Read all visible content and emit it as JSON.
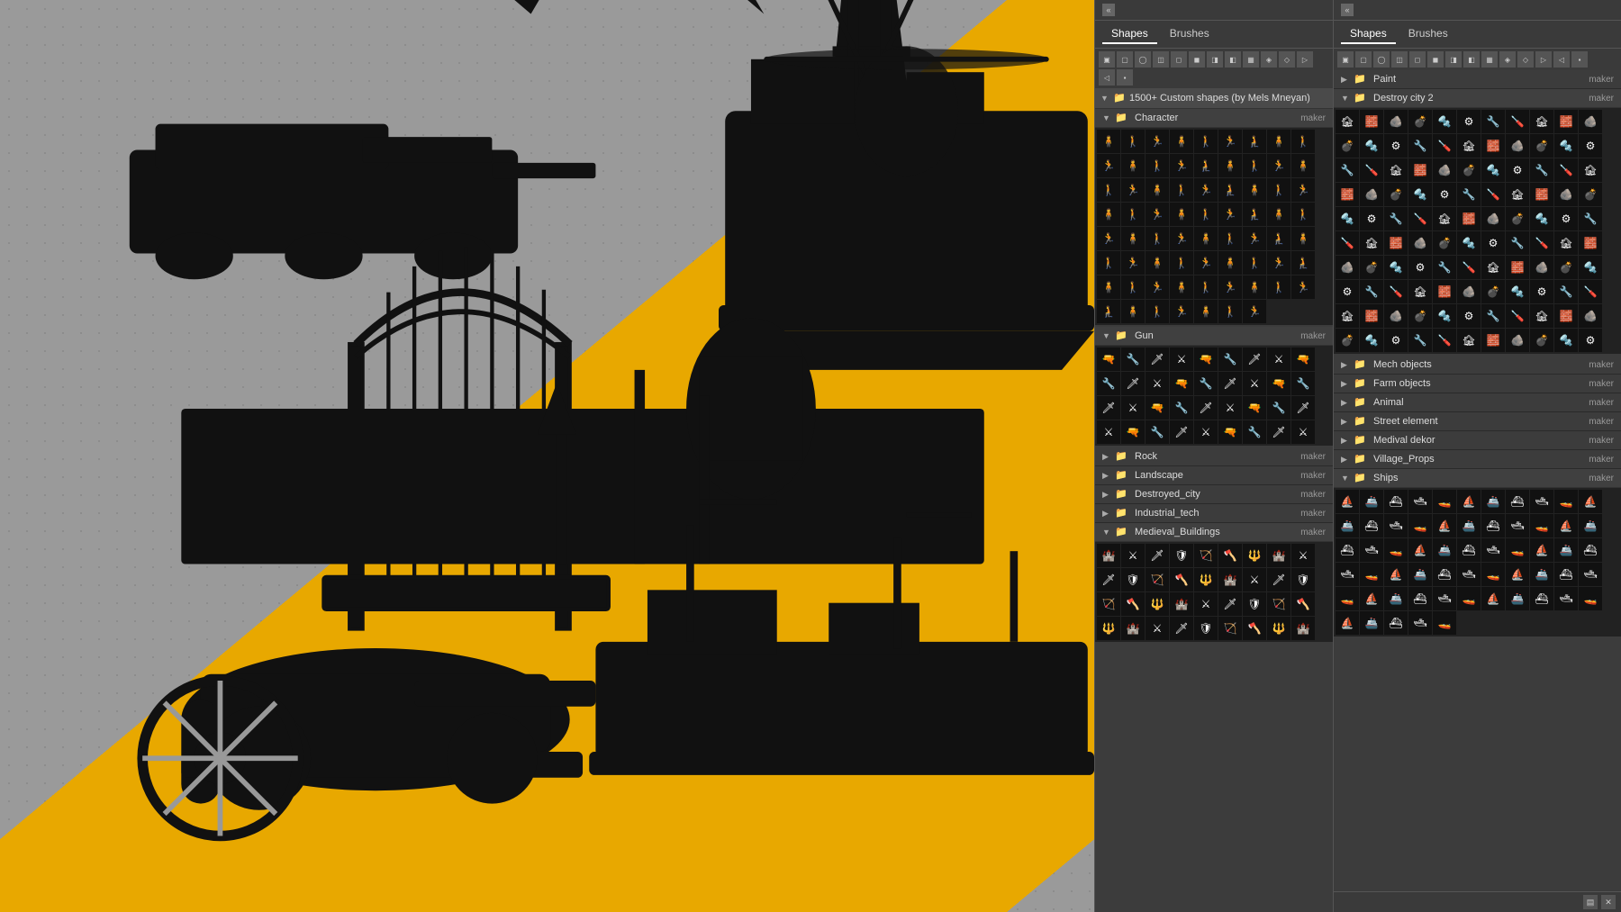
{
  "canvas": {
    "background_color": "#9a9a9a",
    "accent_color": "#e8a800"
  },
  "panel_left": {
    "collapse_btn": "«",
    "tabs": [
      {
        "label": "Shapes",
        "active": true
      },
      {
        "label": "Brushes",
        "active": false
      }
    ],
    "toolbar_icons": [
      "▣",
      "▢",
      "◯",
      "◫",
      "◻",
      "▤",
      "▦",
      "▨",
      "◈",
      "◇",
      "▷",
      "◁",
      "◻",
      "▪",
      "◻",
      "◻",
      "◻",
      "◻"
    ],
    "collection_title": "1500+ Custom shapes (by Mels Mneyan)",
    "groups": [
      {
        "name": "Character",
        "meta": "maker",
        "expanded": true,
        "grid_rows": 5
      },
      {
        "name": "Gun",
        "meta": "maker",
        "expanded": true,
        "grid_rows": 4
      },
      {
        "name": "Rock",
        "meta": "maker",
        "expanded": false
      },
      {
        "name": "Landscape",
        "meta": "maker",
        "expanded": false
      },
      {
        "name": "Destroyed_city",
        "meta": "maker",
        "expanded": false
      },
      {
        "name": "Industrial_tech",
        "meta": "maker",
        "expanded": false
      },
      {
        "name": "Medieval_Buildings",
        "meta": "maker",
        "expanded": true,
        "grid_rows": 4
      }
    ]
  },
  "panel_right": {
    "collapse_btn": "«",
    "tabs": [
      {
        "label": "Shapes",
        "active": true
      },
      {
        "label": "Brushes",
        "active": false
      }
    ],
    "toolbar_icons": [
      "▣",
      "▢",
      "◯",
      "◫",
      "◻",
      "▤",
      "▦",
      "▨",
      "◈",
      "◇",
      "▷",
      "◁",
      "◻",
      "▪",
      "◻",
      "◻",
      "◻",
      "◻"
    ],
    "groups": [
      {
        "name": "Paint",
        "meta": "maker",
        "expanded": false
      },
      {
        "name": "Destroy city 2",
        "meta": "maker",
        "expanded": true,
        "grid_rows": 10
      },
      {
        "name": "Mech objects",
        "meta": "maker",
        "expanded": false
      },
      {
        "name": "Farm objects",
        "meta": "maker",
        "expanded": false
      },
      {
        "name": "Animal",
        "meta": "maker",
        "expanded": false
      },
      {
        "name": "Street element",
        "meta": "maker",
        "expanded": false
      },
      {
        "name": "Medival dekor",
        "meta": "maker",
        "expanded": false
      },
      {
        "name": "Village_Props",
        "meta": "maker",
        "expanded": false
      },
      {
        "name": "Ships",
        "meta": "maker",
        "expanded": true,
        "grid_rows": 6
      }
    ],
    "bottom_icons": [
      "▤",
      "✕"
    ]
  }
}
